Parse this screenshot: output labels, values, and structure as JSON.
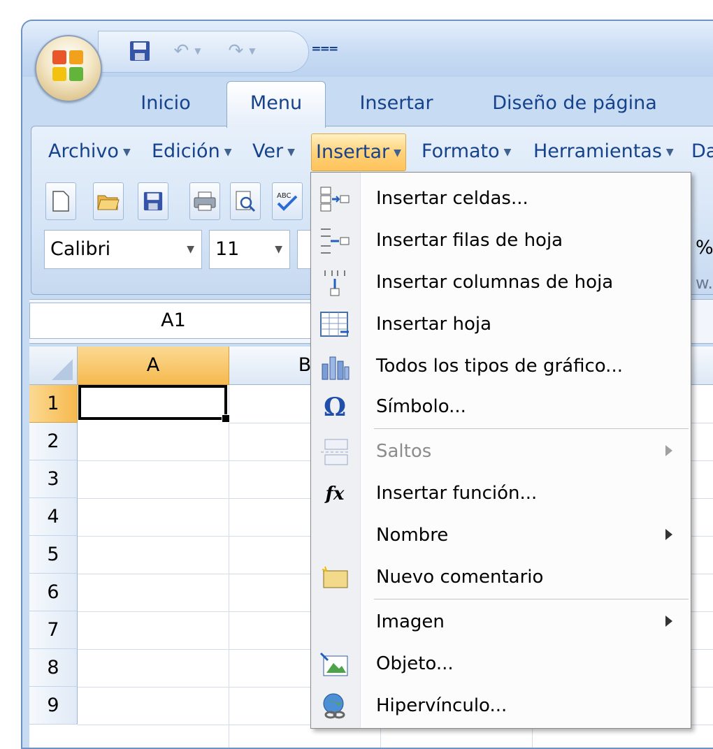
{
  "app": {
    "tabs": [
      "Inicio",
      "Menu",
      "Insertar",
      "Diseño de página"
    ],
    "active_tab": "Menu"
  },
  "menubar": {
    "items": [
      "Archivo",
      "Edición",
      "Ver",
      "Insertar",
      "Formato",
      "Herramientas",
      "Da"
    ],
    "open_item": "Insertar"
  },
  "toolbar": {
    "font_name": "Calibri",
    "font_size": "11",
    "partial_right": "%",
    "partial_right2": "w.c"
  },
  "formula_bar": {
    "name_box": "A1"
  },
  "grid": {
    "columns": [
      "A",
      "B"
    ],
    "rows": [
      "1",
      "2",
      "3",
      "4",
      "5",
      "6",
      "7",
      "8",
      "9"
    ],
    "selected_cell": "A1"
  },
  "insert_menu": {
    "items": [
      {
        "label": "Insertar celdas...",
        "icon": "insert-cells-icon",
        "enabled": true,
        "submenu": false
      },
      {
        "label": "Insertar filas de hoja",
        "icon": "insert-rows-icon",
        "enabled": true,
        "submenu": false
      },
      {
        "label": "Insertar columnas de hoja",
        "icon": "insert-columns-icon",
        "enabled": true,
        "submenu": false
      },
      {
        "label": "Insertar hoja",
        "icon": "insert-sheet-icon",
        "enabled": true,
        "submenu": false
      },
      {
        "label": "Todos los tipos de gráfico...",
        "icon": "chart-icon",
        "enabled": true,
        "submenu": false
      },
      {
        "label": "Símbolo...",
        "icon": "omega-icon",
        "enabled": true,
        "submenu": false
      },
      {
        "label": "Saltos",
        "icon": "page-break-icon",
        "enabled": false,
        "submenu": true
      },
      {
        "label": "Insertar función...",
        "icon": "function-icon",
        "enabled": true,
        "submenu": false
      },
      {
        "label": "Nombre",
        "icon": "",
        "enabled": true,
        "submenu": true
      },
      {
        "label": "Nuevo comentario",
        "icon": "comment-icon",
        "enabled": true,
        "submenu": false
      },
      {
        "label": "Imagen",
        "icon": "",
        "enabled": true,
        "submenu": true
      },
      {
        "label": "Objeto...",
        "icon": "object-icon",
        "enabled": true,
        "submenu": false
      },
      {
        "label": "Hipervínculo...",
        "icon": "hyperlink-icon",
        "enabled": true,
        "submenu": false
      }
    ]
  },
  "colors": {
    "accent": "#15428b",
    "menu_highlight": "#ffc35a",
    "selected_header": "#f6b94e"
  }
}
